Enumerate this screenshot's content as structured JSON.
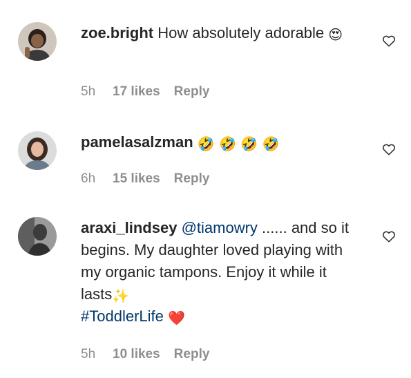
{
  "comments": [
    {
      "username": "zoe.bright",
      "text": "How absolutely adorable",
      "emoji": "😍",
      "time": "5h",
      "likes": "17 likes",
      "reply": "Reply"
    },
    {
      "username": "pamelasalzman",
      "emoji": "🤣 🤣 🤣 🤣",
      "time": "6h",
      "likes": "15 likes",
      "reply": "Reply"
    },
    {
      "username": "araxi_lindsey",
      "mention": "@tiamowry",
      "text": "...... and so it begins. My daughter loved playing with my organic tampons. Enjoy it while it lasts",
      "sparkle": "✨",
      "hashtag": "#ToddlerLife",
      "heart": "❤️",
      "time": "5h",
      "likes": "10 likes",
      "reply": "Reply"
    }
  ],
  "icons": {
    "like": "heart-outline-icon"
  },
  "colors": {
    "text": "#262626",
    "meta": "#8e8e8e",
    "link": "#00376b"
  }
}
